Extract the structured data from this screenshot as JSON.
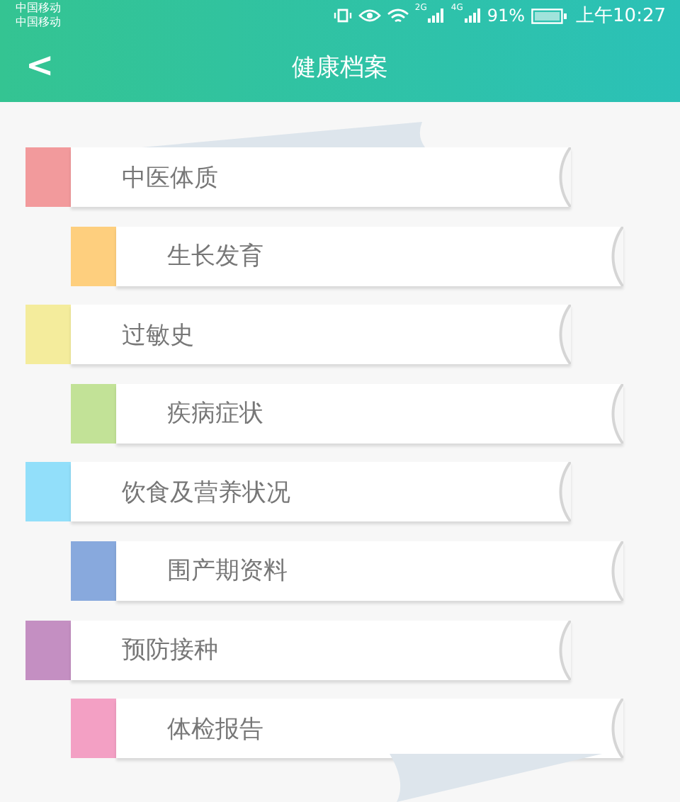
{
  "status_bar": {
    "carriers": [
      "中国移动",
      "中国移动"
    ],
    "network_2g": "2G",
    "network_4g": "4G",
    "battery": "91%",
    "time": "上午10:27"
  },
  "header": {
    "back": "<",
    "title": "健康档案"
  },
  "items": [
    {
      "label": "中医体质",
      "kind": "main",
      "color": "#f29a9c"
    },
    {
      "label": "生长发育",
      "kind": "sub",
      "color": "#fecf7e"
    },
    {
      "label": "过敏史",
      "kind": "main",
      "color": "#f4ec9c"
    },
    {
      "label": "疾病症状",
      "kind": "sub",
      "color": "#c2e297"
    },
    {
      "label": "饮食及营养状况",
      "kind": "main",
      "color": "#92dffa"
    },
    {
      "label": "围产期资料",
      "kind": "sub",
      "color": "#88a9dd"
    },
    {
      "label": "预防接种",
      "kind": "main",
      "color": "#c48fc2"
    },
    {
      "label": "体检报告",
      "kind": "sub",
      "color": "#f3a0c4"
    }
  ]
}
